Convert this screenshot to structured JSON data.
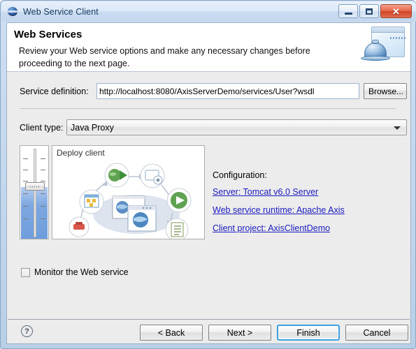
{
  "window": {
    "title": "Web Service Client",
    "icon": "globe-icon",
    "controls": {
      "minimize": "minimize-icon",
      "restore": "restore-icon",
      "close": "✕"
    }
  },
  "header": {
    "title": "Web Services",
    "description": "Review your Web service options and make any necessary changes before proceeding to the next page.",
    "icon": "web-service-bell-icon"
  },
  "form": {
    "service_definition_label": "Service definition:",
    "service_definition_value": "http://localhost:8080/AxisServerDemo/services/User?wsdl",
    "service_definition_placeholder": "",
    "browse_label": "Browse...",
    "client_type_label": "Client type:",
    "client_type_value": "Java Proxy",
    "client_type_options": [
      "Java Proxy"
    ]
  },
  "illustration": {
    "panel_title": "Deploy client",
    "slider_name": "stage-slider"
  },
  "configuration": {
    "title": "Configuration:",
    "links": [
      {
        "label": "Server: Tomcat v6.0 Server",
        "name": "config-link-server"
      },
      {
        "label": "Web service runtime: Apache Axis",
        "name": "config-link-runtime"
      },
      {
        "label": "Client project: AxisClientDemo",
        "name": "config-link-client-project"
      }
    ]
  },
  "options": {
    "monitor_label": "Monitor the Web service",
    "monitor_checked": false
  },
  "buttons": {
    "help": "?",
    "back": "< Back",
    "next": "Next >",
    "finish": "Finish",
    "cancel": "Cancel",
    "focused": "finish"
  },
  "colors": {
    "link": "#1b1bbf",
    "focus_ring": "#3c9fe0",
    "titlebar": "#dbe8f7",
    "body": "#ececec",
    "close_button": "#cf4526",
    "slider_fill": "#7ea8e0"
  }
}
